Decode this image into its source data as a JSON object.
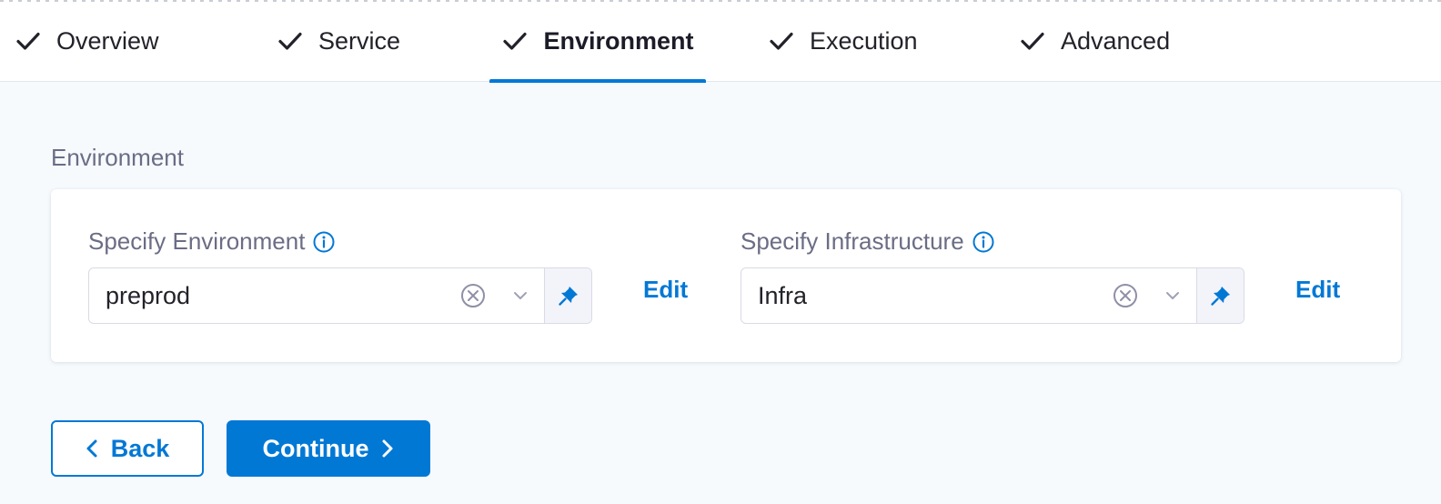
{
  "tabs": [
    {
      "label": "Overview",
      "icon": "check-icon",
      "completed": true,
      "active": false
    },
    {
      "label": "Service",
      "icon": "check-icon",
      "completed": true,
      "active": false
    },
    {
      "label": "Environment",
      "icon": "check-icon",
      "completed": true,
      "active": true
    },
    {
      "label": "Execution",
      "icon": "check-icon",
      "completed": true,
      "active": false
    },
    {
      "label": "Advanced",
      "icon": "check-icon",
      "completed": true,
      "active": false
    }
  ],
  "section": {
    "title": "Environment"
  },
  "environment_field": {
    "label": "Specify Environment",
    "value": "preprod",
    "edit_label": "Edit",
    "icons": [
      "info-icon",
      "clear-icon",
      "chevron-down-icon",
      "pin-icon"
    ]
  },
  "infrastructure_field": {
    "label": "Specify Infrastructure",
    "value": "Infra",
    "edit_label": "Edit",
    "icons": [
      "info-icon",
      "clear-icon",
      "chevron-down-icon",
      "pin-icon"
    ]
  },
  "footer": {
    "back_label": "Back",
    "continue_label": "Continue"
  },
  "colors": {
    "accent": "#0278d5",
    "background": "#f6fafd",
    "label_gray": "#6b6d85",
    "text": "#22222a"
  }
}
